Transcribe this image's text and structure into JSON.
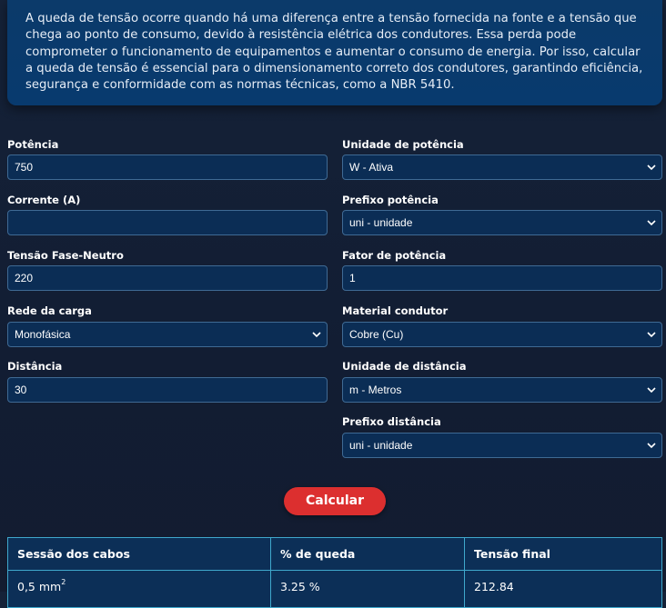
{
  "intro": {
    "text": "A queda de tensão ocorre quando há uma diferença entre a tensão fornecida na fonte e a tensão que chega ao ponto de consumo, devido à resistência elétrica dos condutores. Essa perda pode comprometer o funcionamento de equipamentos e aumentar o consumo de energia. Por isso, calcular a queda de tensão é essencial para o dimensionamento correto dos condutores, garantindo eficiência, segurança e conformidade com as normas técnicas, como a NBR 5410."
  },
  "form": {
    "potencia": {
      "label": "Potência",
      "value": "750"
    },
    "corrente": {
      "label": "Corrente (A)",
      "value": ""
    },
    "tensao": {
      "label": "Tensão Fase-Neutro",
      "value": "220"
    },
    "rede": {
      "label": "Rede da carga",
      "selected": "Monofásica"
    },
    "distancia": {
      "label": "Distância",
      "value": "30"
    },
    "unidade_potencia": {
      "label": "Unidade de potência",
      "selected": "W - Ativa"
    },
    "prefixo_potencia": {
      "label": "Prefixo potência",
      "selected": "uni - unidade"
    },
    "fator_potencia": {
      "label": "Fator de potência",
      "value": "1"
    },
    "material": {
      "label": "Material condutor",
      "selected": "Cobre (Cu)"
    },
    "unidade_distancia": {
      "label": "Unidade de distância",
      "selected": "m - Metros"
    },
    "prefixo_distancia": {
      "label": "Prefixo distância",
      "selected": "uni - unidade"
    }
  },
  "button": {
    "label": "Calcular"
  },
  "results": {
    "headers": [
      "Sessão dos cabos",
      "% de queda",
      "Tensão final"
    ],
    "rows": [
      {
        "secao": "0,5 mm",
        "secao_sup": "2",
        "queda": "3.25 %",
        "tensao_final": "212.84"
      }
    ]
  },
  "icons": {
    "select_arrow": "chevron-down-icon"
  },
  "colors": {
    "background": "#131e34",
    "intro_panel": "#0a3a6c",
    "field_bg": "#0b2d55",
    "field_border": "#3f6a94",
    "button": "#dc2f2f",
    "table_border": "#3fa8cc"
  }
}
